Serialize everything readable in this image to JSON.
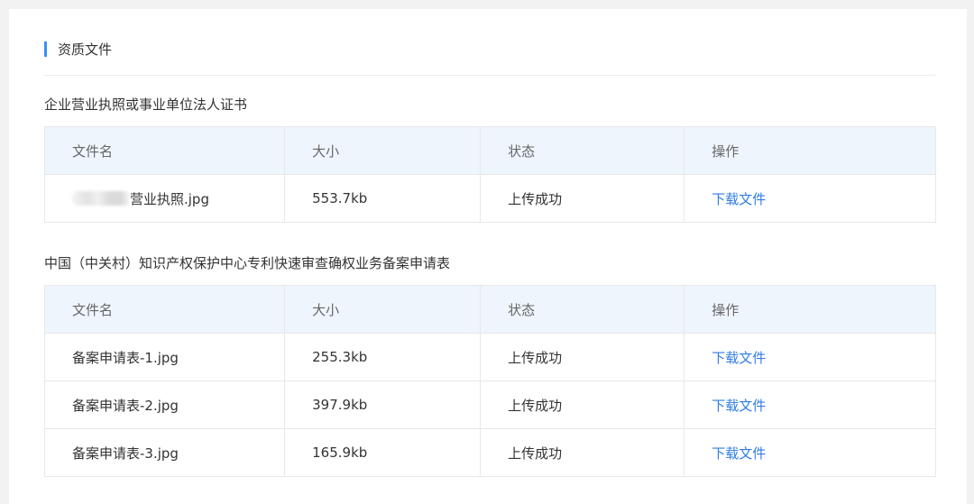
{
  "section": {
    "title": "资质文件"
  },
  "columns": {
    "name": "文件名",
    "size": "大小",
    "status": "状态",
    "action": "操作"
  },
  "groups": [
    {
      "title": "企业营业执照或事业单位法人证书",
      "rows": [
        {
          "name": "营业执照.jpg",
          "name_prefix_redacted": true,
          "size": "553.7kb",
          "status": "上传成功",
          "action": "下载文件"
        }
      ]
    },
    {
      "title": "中国（中关村）知识产权保护中心专利快速审查确权业务备案申请表",
      "rows": [
        {
          "name": "备案申请表-1.jpg",
          "size": "255.3kb",
          "status": "上传成功",
          "action": "下载文件"
        },
        {
          "name": "备案申请表-2.jpg",
          "size": "397.9kb",
          "status": "上传成功",
          "action": "下载文件"
        },
        {
          "name": "备案申请表-3.jpg",
          "size": "165.9kb",
          "status": "上传成功",
          "action": "下载文件"
        }
      ]
    }
  ],
  "colors": {
    "accent": "#3d8ef5",
    "link": "#2f7de1",
    "header_bg": "#eef5fd",
    "page_bg": "#f2f2f2"
  }
}
